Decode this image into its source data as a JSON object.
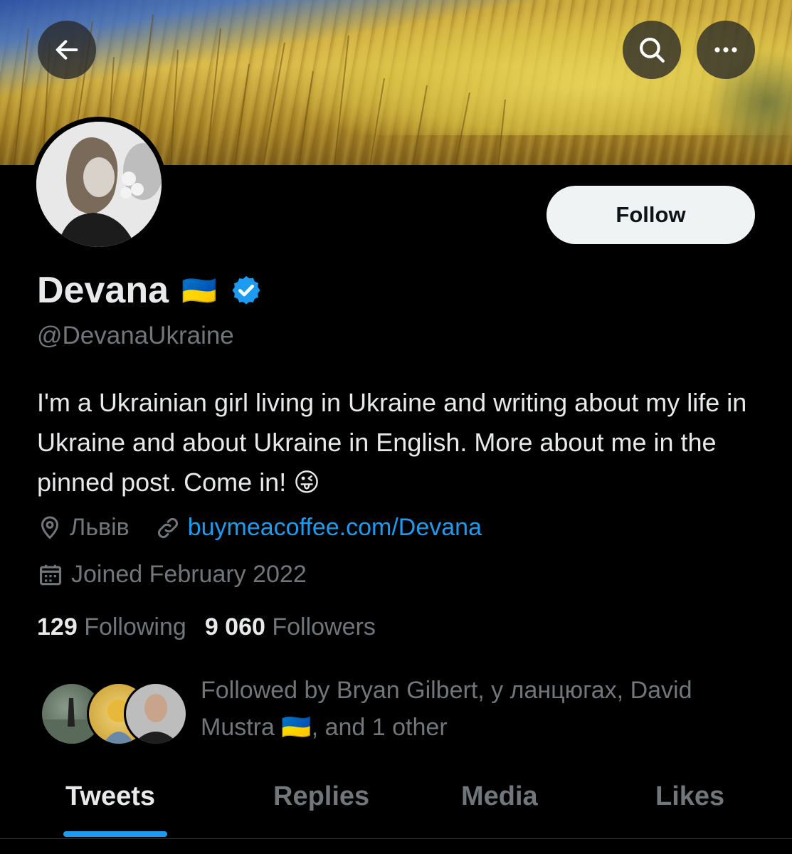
{
  "profile": {
    "name": "Devana",
    "flag": "🇺🇦",
    "handle": "@DevanaUkraine",
    "bio": "I'm a Ukrainian girl living in Ukraine and writing about my life in Ukraine and about Ukraine in English. More about me in the pinned post. Come in! 😜",
    "location": "Львів",
    "website": "buymeacoffee.com/Devana",
    "joined": "Joined February 2022",
    "verified_color": "#1d9bf0"
  },
  "header": {
    "back_icon": "arrow-left-icon",
    "search_icon": "search-icon",
    "more_icon": "more-horizontal-icon"
  },
  "actions": {
    "follow_label": "Follow"
  },
  "stats": {
    "following_count": "129",
    "following_label": "Following",
    "followers_count": "9 060",
    "followers_label": "Followers"
  },
  "followed_by": {
    "line1": "Followed by Bryan Gilbert, у ланцюгах, David",
    "line2_name": "Mustra",
    "line2_flag": "🇺🇦",
    "line2_rest": ", and 1 other"
  },
  "tabs": [
    {
      "label": "Tweets",
      "active": true
    },
    {
      "label": "Replies",
      "active": false
    },
    {
      "label": "Media",
      "active": false
    },
    {
      "label": "Likes",
      "active": false
    }
  ],
  "colors": {
    "accent": "#1d9bf0",
    "background": "#000000",
    "muted": "#71767b",
    "text": "#e7e9ea"
  }
}
